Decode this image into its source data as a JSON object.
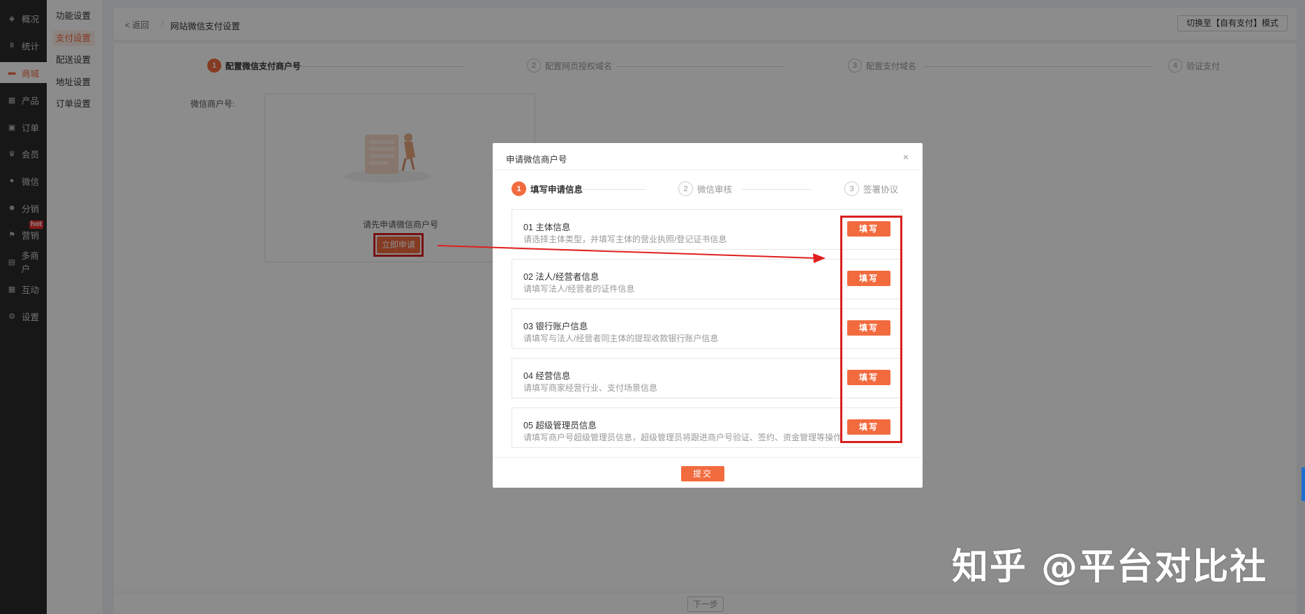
{
  "sidebar": {
    "items": [
      {
        "label": "概况",
        "icon": "layers-icon"
      },
      {
        "label": "统计",
        "icon": "chart-icon"
      },
      {
        "label": "商城",
        "icon": "shop-icon"
      },
      {
        "label": "产品",
        "icon": "grid-icon"
      },
      {
        "label": "订单",
        "icon": "order-icon"
      },
      {
        "label": "会员",
        "icon": "crown-icon"
      },
      {
        "label": "微信",
        "icon": "chat-icon"
      },
      {
        "label": "分销",
        "icon": "user-icon"
      },
      {
        "label": "营销",
        "icon": "flag-icon"
      },
      {
        "label": "多商户",
        "icon": "store-icon"
      },
      {
        "label": "互动",
        "icon": "apps-icon"
      },
      {
        "label": "设置",
        "icon": "gear-icon"
      }
    ],
    "hot_badge": "hot"
  },
  "subnav": {
    "items": [
      "功能设置",
      "支付设置",
      "配送设置",
      "地址设置",
      "订单设置"
    ]
  },
  "header": {
    "back": "< 返回",
    "separator": "/",
    "title": "网站微信支付设置",
    "mode_button": "切换至【自有支付】模式"
  },
  "steps": [
    {
      "num": "1",
      "label": "配置微信支付商户号"
    },
    {
      "num": "2",
      "label": "配置网页授权域名"
    },
    {
      "num": "3",
      "label": "配置支付域名"
    },
    {
      "num": "4",
      "label": "验证支付"
    }
  ],
  "form": {
    "merchant_label": "微信商户号:",
    "apply_tip": "请先申请微信商户号",
    "apply_button": "立即申请"
  },
  "footer": {
    "next_button": "下一步"
  },
  "modal": {
    "title": "申请微信商户号",
    "close": "×",
    "steps": [
      {
        "num": "1",
        "label": "填写申请信息"
      },
      {
        "num": "2",
        "label": "微信审核"
      },
      {
        "num": "3",
        "label": "签署协议"
      }
    ],
    "cards": [
      {
        "title": "01  主体信息",
        "desc": "请选择主体类型，并填写主体的营业执照/登记证书信息",
        "button": "填写"
      },
      {
        "title": "02  法人/经营者信息",
        "desc": "请填写法人/经营者的证件信息",
        "button": "填写"
      },
      {
        "title": "03  银行账户信息",
        "desc": "请填写与法人/经营者同主体的提现收款银行账户信息",
        "button": "填写"
      },
      {
        "title": "04  经营信息",
        "desc": "请填写商家经营行业、支付场景信息",
        "button": "填写"
      },
      {
        "title": "05  超级管理员信息",
        "desc": "请填写商户号超级管理员信息，超级管理员将跟进商户号验证、签约、资金管理等操作",
        "button": "填写"
      }
    ],
    "submit_button": "提交"
  },
  "watermark": "知乎 @平台对比社",
  "colors": {
    "accent": "#f26b3f",
    "sidebar": "#2b2b2b",
    "highlight": "#d9201f"
  }
}
